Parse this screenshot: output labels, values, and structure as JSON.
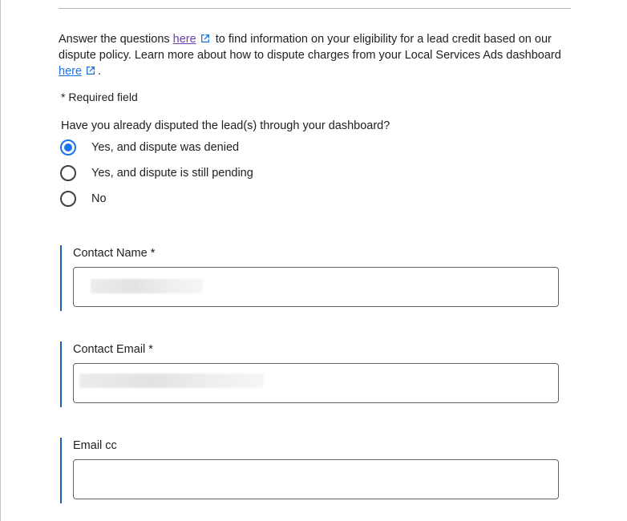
{
  "intro": {
    "text_before": "Answer the questions ",
    "link1_label": "here",
    "text_middle": " to find information on your eligibility for a lead credit based on our dispute policy. Learn more about how to dispute charges from your Local Services Ads dashboard ",
    "link2_label": "here",
    "text_after": "."
  },
  "required_note": "* Required field",
  "dispute_question": {
    "label": "Have you already disputed the lead(s) through your dashboard?",
    "options": [
      {
        "label": "Yes, and dispute was denied",
        "selected": true
      },
      {
        "label": "Yes, and dispute is still pending",
        "selected": false
      },
      {
        "label": "No",
        "selected": false
      }
    ]
  },
  "fields": {
    "contact_name": {
      "label": "Contact Name *",
      "value": ""
    },
    "contact_email": {
      "label": "Contact Email *",
      "value": ""
    },
    "email_cc": {
      "label": "Email cc",
      "value": ""
    }
  },
  "colors": {
    "accent": "#1a73e8",
    "visited_link": "#6b3fb0",
    "field_bar": "#1a5fb4"
  }
}
